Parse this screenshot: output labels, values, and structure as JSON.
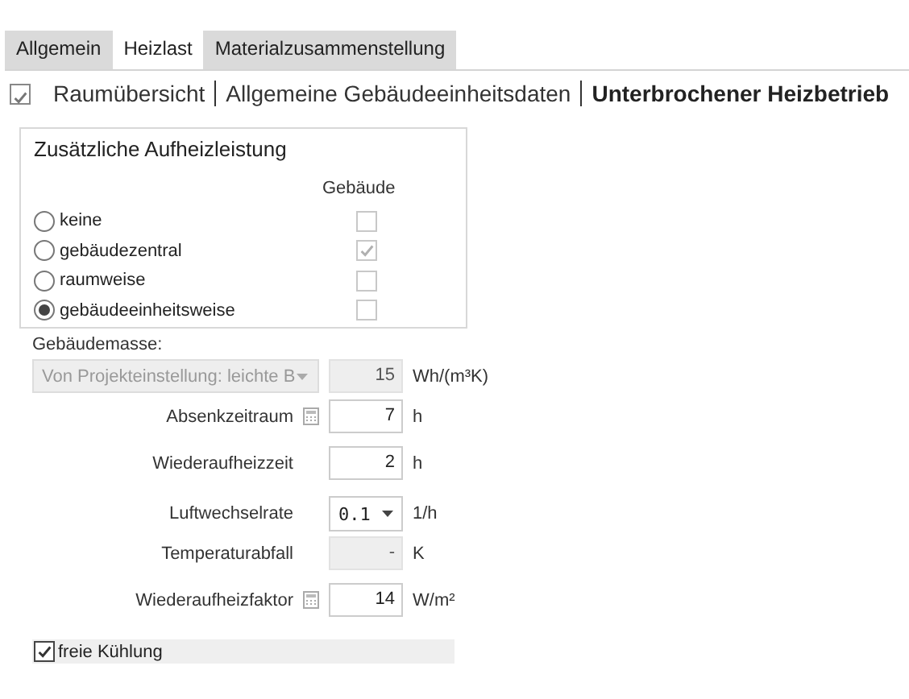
{
  "tabs": [
    {
      "label": "Allgemein",
      "selected": false
    },
    {
      "label": "Heizlast",
      "selected": true
    },
    {
      "label": "Materialzusammenstellung",
      "selected": false
    }
  ],
  "breadcrumb": {
    "checked": true,
    "items": [
      {
        "label": "Raumübersicht",
        "selected": false
      },
      {
        "label": "Allgemeine Gebäudeeinheitsdaten",
        "selected": false
      },
      {
        "label": "Unterbrochener Heizbetrieb",
        "selected": true
      }
    ]
  },
  "heating_group": {
    "title": "Zusätzliche Aufheizleistung",
    "column_header": "Gebäude",
    "options": [
      {
        "label": "keine",
        "selected": false,
        "building_checked": false
      },
      {
        "label": "gebäudezentral",
        "selected": false,
        "building_checked": true
      },
      {
        "label": "raumweise",
        "selected": false,
        "building_checked": false
      },
      {
        "label": "gebäudeeinheitsweise",
        "selected": true,
        "building_checked": false
      }
    ]
  },
  "building_mass": {
    "label": "Gebäudemasse:",
    "source": "Von Projekteinstellung: leichte B",
    "value": "15",
    "unit": "Wh/(m³K)"
  },
  "rows": [
    {
      "kind": "field",
      "label": "Absenkzeitraum",
      "calculator": true,
      "value": "7",
      "unit": "h"
    },
    {
      "kind": "field",
      "label": "Wiederaufheizzeit",
      "calculator": false,
      "value": "2",
      "unit": "h"
    },
    {
      "kind": "dropdown",
      "label": "Luftwechselrate",
      "value": "0.1",
      "unit": "1/h"
    },
    {
      "kind": "readonly",
      "label": "Temperaturabfall",
      "value": "-",
      "unit": "K"
    },
    {
      "kind": "field",
      "label": "Wiederaufheizfaktor",
      "calculator": true,
      "value": "14",
      "unit": "W/m²"
    }
  ],
  "free_cooling": {
    "label": "freie Kühlung",
    "checked": true
  }
}
